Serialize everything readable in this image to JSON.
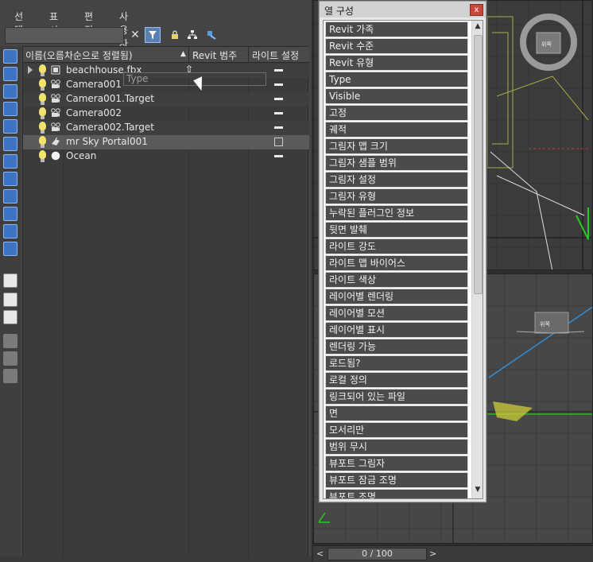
{
  "menu": [
    "선택",
    "표시",
    "편집",
    "사용자화"
  ],
  "explorer": {
    "columns": {
      "name": "이름(오름차순으로 정렬됨)",
      "revit_category": "Revit 범주",
      "light_setting": "라이트 설정"
    },
    "rows": [
      {
        "name": "beachhouse.fbx",
        "light": "dash"
      },
      {
        "name": "Camera001",
        "light": "dash"
      },
      {
        "name": "Camera001.Target",
        "light": "dash"
      },
      {
        "name": "Camera002",
        "light": "dash"
      },
      {
        "name": "Camera002.Target",
        "light": "dash"
      },
      {
        "name": "mr Sky Portal001",
        "light": "box"
      },
      {
        "name": "Ocean",
        "light": "dash"
      }
    ],
    "drag_ghost": "Type"
  },
  "dialog": {
    "title": "열 구성",
    "close": "x",
    "items": [
      "Revit 가족",
      "Revit 수준",
      "Revit 유형",
      "Type",
      "Visible",
      "고정",
      "궤적",
      "그림자 맵 크기",
      "그림자 샘플 범위",
      "그림자 설정",
      "그림자 유형",
      "누락된 플러그인 정보",
      "뒷면 발췌",
      "라이트 강도",
      "라이트 맵 바이어스",
      "라이트 색상",
      "레이어별 렌더링",
      "레이어별 모션",
      "레이어별 표시",
      "렌더링 가능",
      "로드됨?",
      "로컬 정의",
      "링크되어 있는 파일",
      "면",
      "모서리만",
      "범위 무시",
      "뷰포트 그림자",
      "뷰포트 잠금 조명",
      "뷰포트 조명"
    ]
  },
  "timeline": {
    "frame": "0 / 100",
    "prev": "<",
    "next": ">"
  },
  "viewcube": {
    "label": "위쪽"
  },
  "colors": {
    "accent": "#3c73c2",
    "panel": "#444444",
    "dialog_item": "#4b4b4b"
  }
}
